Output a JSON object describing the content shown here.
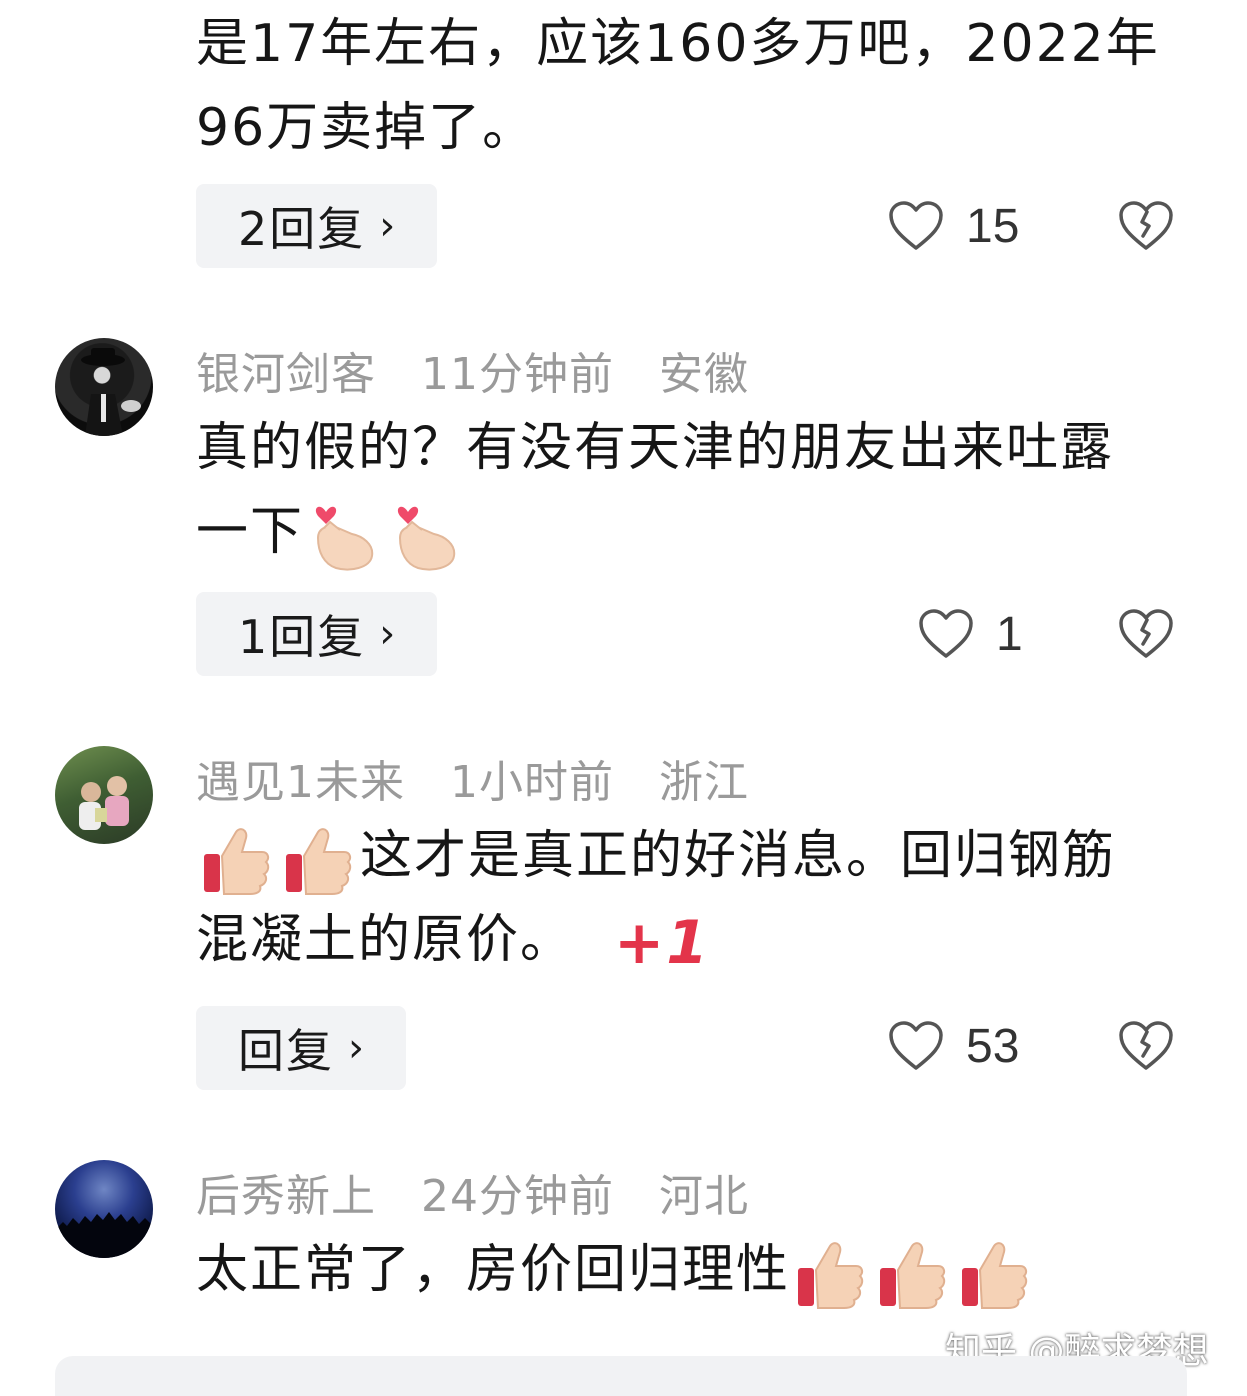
{
  "comments": [
    {
      "text_lines": [
        "是17年左右，应该160多万吧，2022年",
        "96万卖掉了。"
      ],
      "reply_label": "2回复",
      "likes": "15"
    },
    {
      "user": "银河剑客",
      "time": "11分钟前",
      "location": "安徽",
      "text_line1": "真的假的？有没有天津的朋友出来吐露",
      "text_line2": "一下",
      "emojis": [
        "finger-heart-icon",
        "finger-heart-icon"
      ],
      "reply_label": "1回复",
      "likes": "1"
    },
    {
      "user": "遇见1未来",
      "time": "1小时前",
      "location": "浙江",
      "text_line1": "这才是真正的好消息。回归钢筋",
      "text_line2": "混凝土的原价。",
      "plus_one": "+1",
      "emojis": [
        "thumbs-up-icon",
        "thumbs-up-icon"
      ],
      "reply_label": "回复",
      "likes": "53"
    },
    {
      "user": "后秀新上",
      "time": "24分钟前",
      "location": "河北",
      "text_line1": "太正常了，房价回归理性",
      "emojis": [
        "thumbs-up-icon",
        "thumbs-up-icon",
        "thumbs-up-icon"
      ]
    }
  ],
  "reply_chevron": "›",
  "watermark": "知乎 @醉求梦想",
  "colors": {
    "meta_text": "#9a9a9a",
    "reply_bg": "#f2f3f5",
    "accent_red": "#e3344a"
  }
}
